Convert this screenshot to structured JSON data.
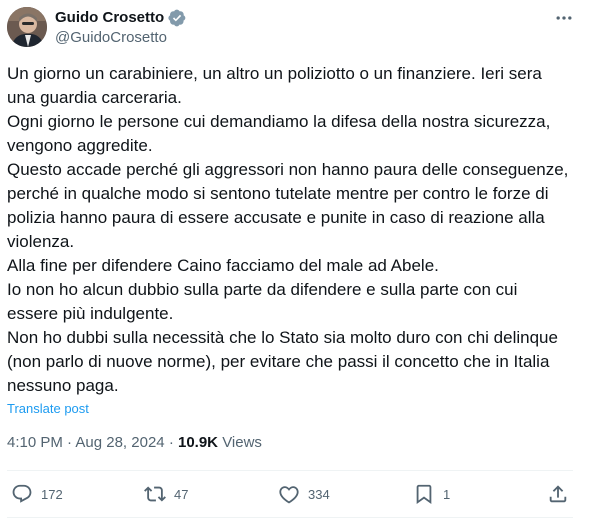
{
  "author": {
    "name": "Guido Crosetto",
    "handle": "@GuidoCrosetto"
  },
  "tweet": {
    "lines": [
      "Un giorno un carabiniere, un altro un poliziotto o un finanziere. Ieri sera una guardia carceraria.",
      "Ogni giorno le persone cui demandiamo la difesa della nostra sicurezza, vengono aggredite.",
      "Questo accade perché gli aggressori non hanno paura delle conseguenze, perché in qualche modo si sentono tutelate mentre per contro le forze di polizia hanno paura di essere accusate e punite in caso di reazione alla violenza.",
      "Alla fine per difendere Caino facciamo del male ad Abele.",
      "Io non ho alcun dubbio sulla parte da difendere e sulla parte con cui essere più indulgente.",
      "Non ho dubbi sulla necessità che lo Stato sia molto duro con chi delinque (non parlo di nuove norme), per evitare che passi il concetto che in Italia nessuno paga."
    ],
    "translate_label": "Translate post",
    "time": "4:10 PM",
    "sep": "·",
    "date": "Aug 28, 2024",
    "views_count": "10.9K",
    "views_label": "Views"
  },
  "actions": {
    "replies": "172",
    "reposts": "47",
    "likes": "334",
    "bookmarks": "1"
  },
  "icons": {
    "verified": "verified-badge-icon",
    "more": "more-horizontal-icon",
    "reply": "reply-icon",
    "repost": "repost-icon",
    "like": "heart-icon",
    "bookmark": "bookmark-icon",
    "share": "share-icon"
  },
  "colors": {
    "accent": "#1d9bf0",
    "text": "#0f1419",
    "muted": "#536471",
    "divider": "#eff3f4"
  }
}
